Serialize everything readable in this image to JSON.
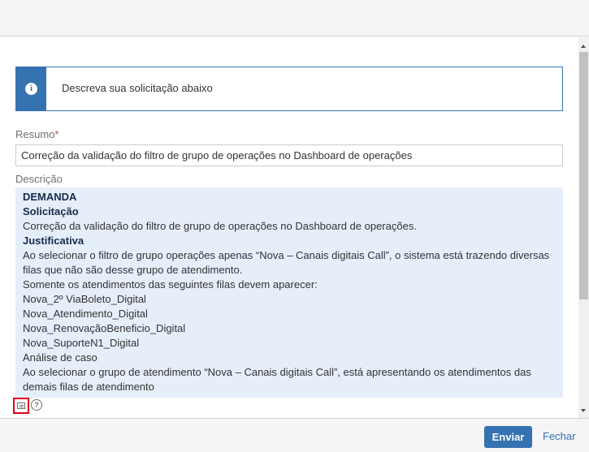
{
  "banner": {
    "message": "Descreva sua solicitação abaixo"
  },
  "summary": {
    "label": "Resumo",
    "required_mark": "*",
    "value": "Correção da validação do filtro de grupo de operações no Dashboard de operações"
  },
  "description": {
    "label": "Descrição",
    "lines": [
      "DEMANDA",
      "Solicitação",
      "Correção da validação do filtro de grupo de operações no Dashboard de operações.",
      "Justificativa",
      "Ao selecionar o filtro de grupo operações apenas “Nova – Canais digitais Call”, o sistema está trazendo diversas filas que não são desse grupo de atendimento.",
      "Somente os atendimentos das seguintes filas devem aparecer:",
      "Nova_2º ViaBoleto_Digital",
      "Nova_Atendimento_Digital",
      "Nova_RenovaçãoBeneficio_Digital",
      "Nova_SuporteN1_Digital",
      "Análise de caso",
      "Ao selecionar o grupo de atendimento “Nova – Canais digitais Call”, está apresentando os atendimentos das demais filas de atendimento"
    ]
  },
  "icons": {
    "toggle_editor": "text-editor-icon",
    "help": "help-icon",
    "help_glyph": "?"
  },
  "footer": {
    "send_label": "Enviar",
    "close_label": "Fechar"
  },
  "colors": {
    "primary": "#3572b0",
    "highlight": "#e0001b",
    "description_bg": "#e6eefa"
  }
}
